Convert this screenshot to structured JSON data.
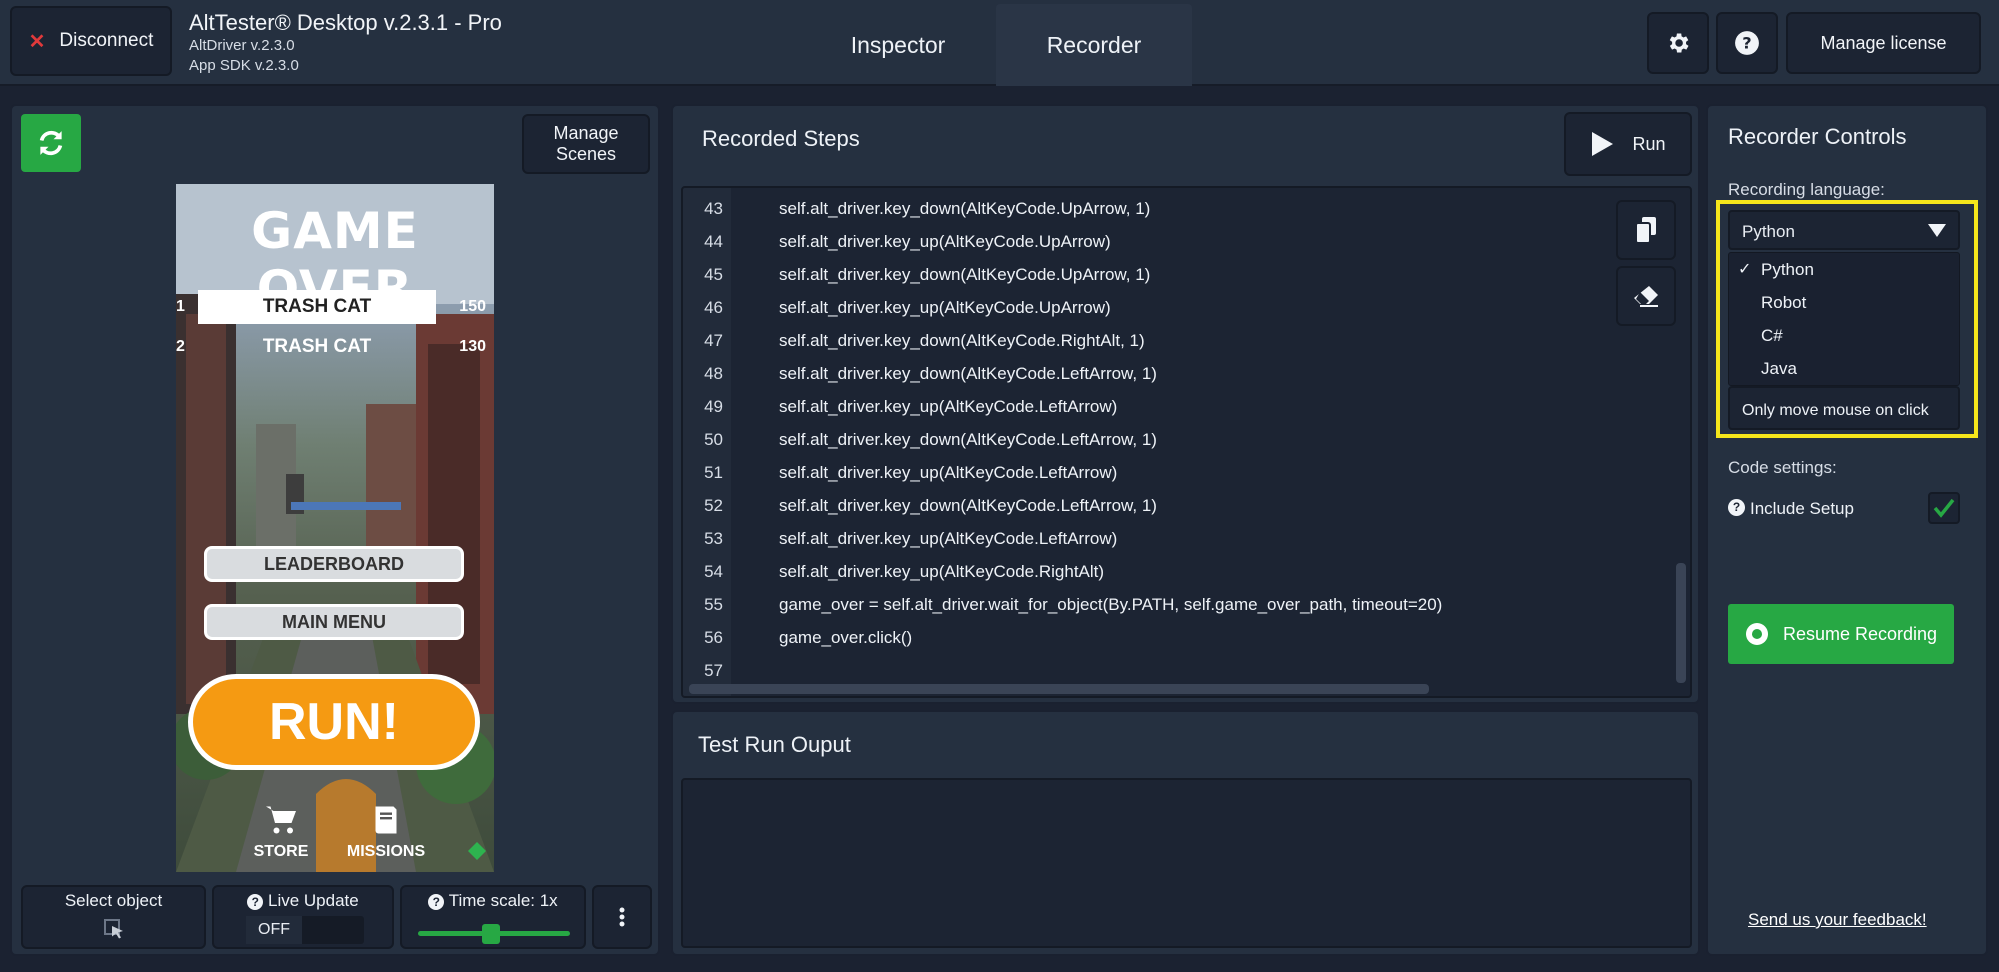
{
  "header": {
    "disconnect_label": "Disconnect",
    "app_title": "AltTester® Desktop v.2.3.1 - Pro",
    "altdriver_version": "AltDriver v.2.3.0",
    "sdk_version": "App SDK v.2.3.0",
    "tabs": [
      {
        "label": "Inspector"
      },
      {
        "label": "Recorder"
      }
    ],
    "manage_license_label": "Manage license"
  },
  "left": {
    "manage_scenes_label": "Manage\nScenes",
    "game": {
      "title": "GAME OVER",
      "rows": [
        {
          "rank": "1",
          "name": "TRASH CAT",
          "score": "150"
        },
        {
          "rank": "2",
          "name": "TRASH CAT",
          "score": "130"
        }
      ],
      "leaderboard_label": "LEADERBOARD",
      "main_menu_label": "MAIN MENU",
      "run_label": "RUN!",
      "store_label": "STORE",
      "missions_label": "MISSIONS"
    },
    "select_object_label": "Select object",
    "live_update_label": "Live Update",
    "live_update_value": "OFF",
    "time_scale_label": "Time scale: 1x",
    "time_scale_value": 1
  },
  "recorded_steps": {
    "title": "Recorded Steps",
    "run_label": "Run",
    "lines": [
      {
        "n": "43",
        "code": "self.alt_driver.key_down(AltKeyCode.UpArrow, 1)"
      },
      {
        "n": "44",
        "code": "self.alt_driver.key_up(AltKeyCode.UpArrow)"
      },
      {
        "n": "45",
        "code": "self.alt_driver.key_down(AltKeyCode.UpArrow, 1)"
      },
      {
        "n": "46",
        "code": "self.alt_driver.key_up(AltKeyCode.UpArrow)"
      },
      {
        "n": "47",
        "code": "self.alt_driver.key_down(AltKeyCode.RightAlt, 1)"
      },
      {
        "n": "48",
        "code": "self.alt_driver.key_down(AltKeyCode.LeftArrow, 1)"
      },
      {
        "n": "49",
        "code": "self.alt_driver.key_up(AltKeyCode.LeftArrow)"
      },
      {
        "n": "50",
        "code": "self.alt_driver.key_down(AltKeyCode.LeftArrow, 1)"
      },
      {
        "n": "51",
        "code": "self.alt_driver.key_up(AltKeyCode.LeftArrow)"
      },
      {
        "n": "52",
        "code": "self.alt_driver.key_down(AltKeyCode.LeftArrow, 1)"
      },
      {
        "n": "53",
        "code": "self.alt_driver.key_up(AltKeyCode.LeftArrow)"
      },
      {
        "n": "54",
        "code": "self.alt_driver.key_up(AltKeyCode.RightAlt)"
      },
      {
        "n": "55",
        "code": "game_over = self.alt_driver.wait_for_object(By.PATH, self.game_over_path, timeout=20)"
      },
      {
        "n": "56",
        "code": "game_over.click()"
      },
      {
        "n": "57",
        "code": ""
      }
    ]
  },
  "test_run": {
    "title": "Test Run Ouput"
  },
  "recorder_controls": {
    "title": "Recorder Controls",
    "recording_language_label": "Recording language:",
    "selected_language": "Python",
    "language_options": [
      {
        "label": "Python",
        "checked": true
      },
      {
        "label": "Robot",
        "checked": false
      },
      {
        "label": "C#",
        "checked": false
      },
      {
        "label": "Java",
        "checked": false
      }
    ],
    "mouse_option_partial": "Only move mouse on click",
    "code_settings_label": "Code settings:",
    "include_setup_label": "Include Setup",
    "include_setup_checked": true,
    "resume_label": "Resume Recording",
    "feedback_label": "Send us your feedback!"
  },
  "colors": {
    "accent_green": "#27a844",
    "highlight_yellow": "#f5e61b",
    "danger_red": "#e0393b",
    "run_orange": "#f59a12"
  }
}
